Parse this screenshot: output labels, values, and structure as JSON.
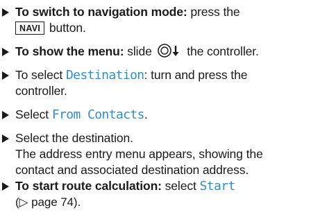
{
  "steps": [
    {
      "lead": "To switch to navigation mode:",
      "text1": " press the",
      "key": "NAVI",
      "text2": " button."
    },
    {
      "lead": "To show the menu:",
      "text1": " slide ",
      "text2": " the controller."
    },
    {
      "text1": "To select ",
      "display": "Destination",
      "text2": ": turn and press the",
      "line2": "controller."
    },
    {
      "text1": "Select ",
      "display": "From Contacts",
      "text2": "."
    },
    {
      "text1": "Select the destination.",
      "line2": "The address entry menu appears, showing the",
      "line3": "contact and associated destination address."
    },
    {
      "lead": "To start route calculation:",
      "text1": " select ",
      "display": "Start",
      "line2": "(▷ page 74)."
    }
  ],
  "icons": {
    "bullet": "triangle-bullet-icon",
    "controller": "controller-slide-down-icon"
  },
  "colors": {
    "text": "#1a1a1a",
    "display_text": "#2f8fce"
  }
}
